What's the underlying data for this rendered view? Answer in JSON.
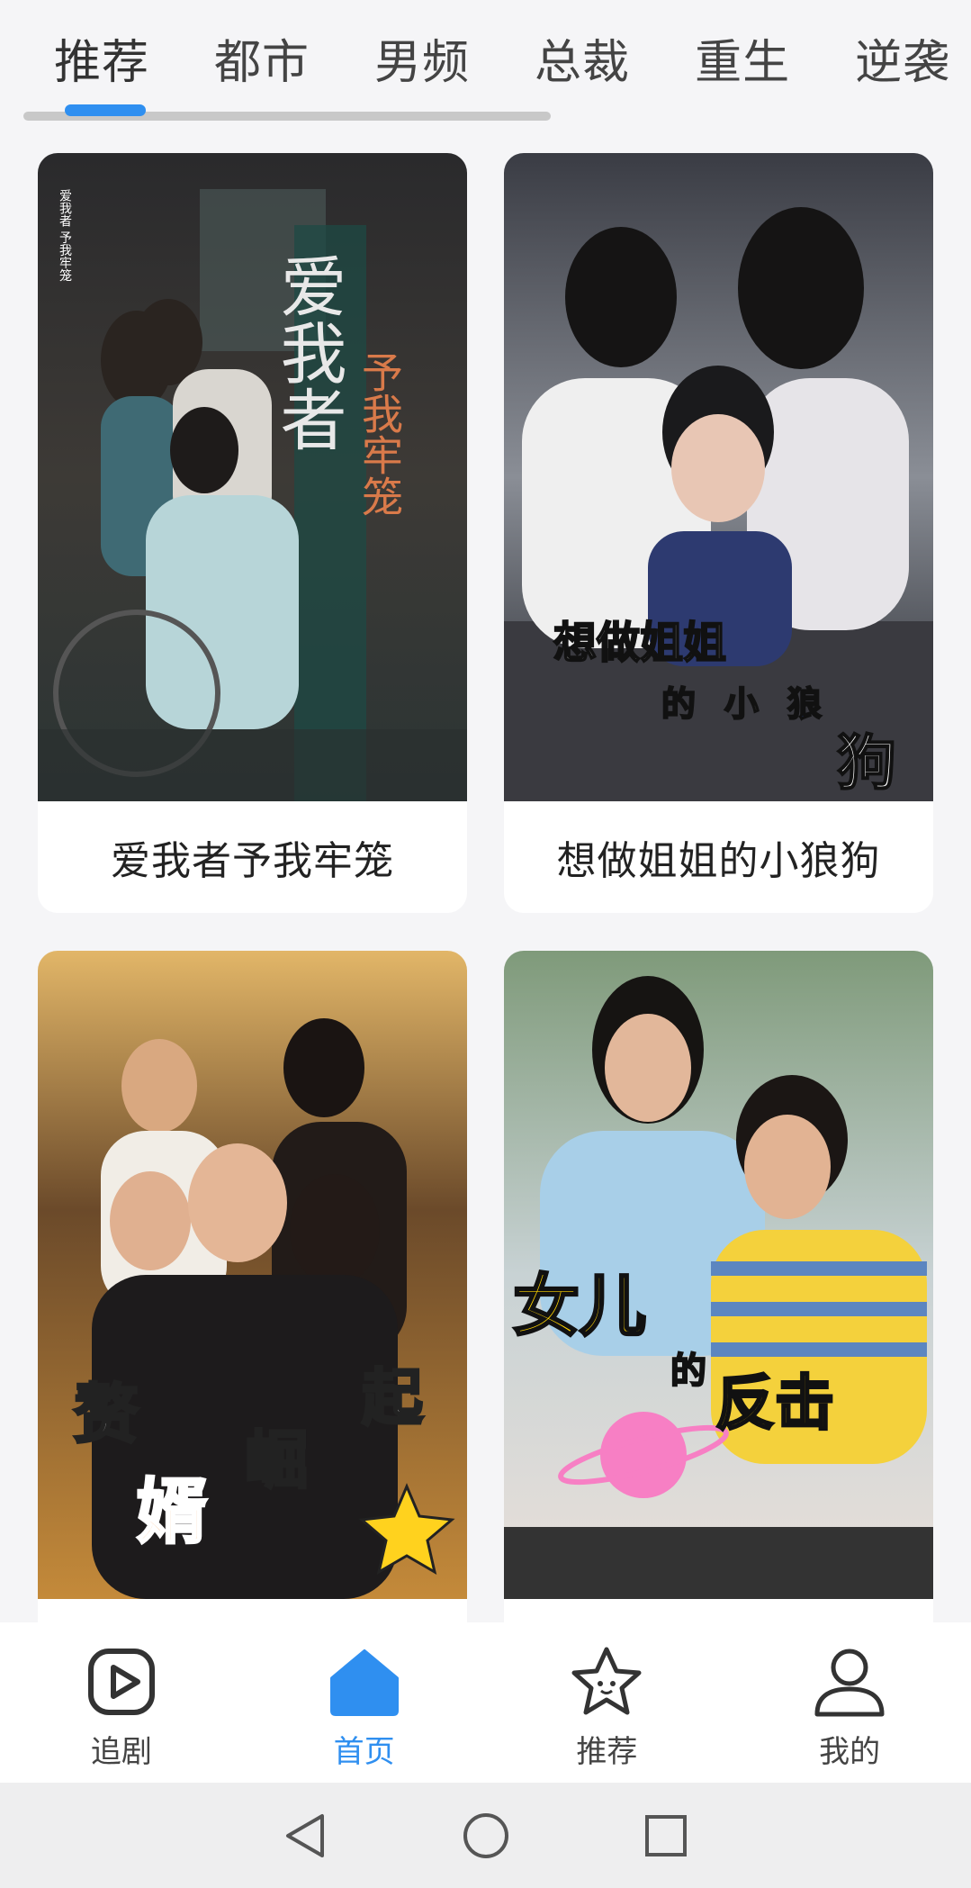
{
  "tabs": [
    {
      "label": "推荐",
      "active": true
    },
    {
      "label": "都市",
      "active": false
    },
    {
      "label": "男频",
      "active": false
    },
    {
      "label": "总裁",
      "active": false
    },
    {
      "label": "重生",
      "active": false
    },
    {
      "label": "逆袭",
      "active": false
    }
  ],
  "cards": [
    {
      "title": "爱我者予我牢笼",
      "poster_text_big": "爱我者",
      "poster_text_side": "予我牢笼",
      "poster_text_small": "爱我者 予我牢笼"
    },
    {
      "title": "想做姐姐的小狼狗",
      "poster_text_line1": "想做姐姐",
      "poster_text_line2a": "的",
      "poster_text_line2b": "小",
      "poster_text_line2c": "狼",
      "poster_text_line3": "狗"
    },
    {
      "title": "",
      "poster_text_1": "赘",
      "poster_text_2": "婿",
      "poster_text_3": "崛",
      "poster_text_4": "起"
    },
    {
      "title": "",
      "poster_text_1": "女儿",
      "poster_text_2": "的",
      "poster_text_3": "反击"
    }
  ],
  "bottom_nav": [
    {
      "label": "追剧",
      "icon": "play-icon",
      "active": false
    },
    {
      "label": "首页",
      "icon": "home-icon",
      "active": true
    },
    {
      "label": "推荐",
      "icon": "star-icon",
      "active": false
    },
    {
      "label": "我的",
      "icon": "user-icon",
      "active": false
    }
  ],
  "colors": {
    "accent": "#2f8ff0",
    "background": "#f5f5f7"
  }
}
